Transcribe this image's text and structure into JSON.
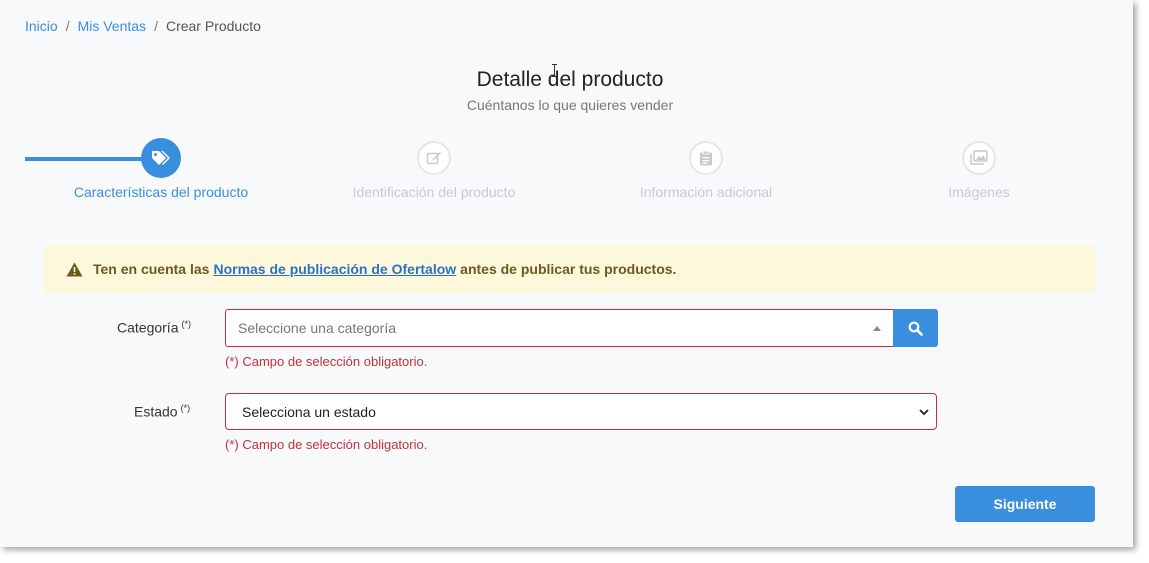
{
  "breadcrumb": {
    "items": [
      "Inicio",
      "Mis Ventas"
    ],
    "current": "Crear Producto",
    "separator": "/"
  },
  "header": {
    "title": "Detalle del producto",
    "subtitle": "Cuéntanos lo que quieres vender"
  },
  "steps": [
    {
      "label": "Características del producto",
      "icon": "tags-icon",
      "state": "active"
    },
    {
      "label": "Identificación del producto",
      "icon": "edit-icon",
      "state": "inactive"
    },
    {
      "label": "Información adicional",
      "icon": "clipboard-icon",
      "state": "inactive"
    },
    {
      "label": "Imágenes",
      "icon": "images-icon",
      "state": "inactive"
    }
  ],
  "alert": {
    "prefix": "Ten en cuenta las",
    "link": "Normas de publicación de Ofertalow",
    "suffix": "antes de publicar tus productos.",
    "icon": "warning-icon"
  },
  "form": {
    "category": {
      "label": "Categoría",
      "required_mark": "(*)",
      "placeholder": "Seleccione una categoría",
      "error": "(*) Campo de selección obligatorio."
    },
    "state": {
      "label": "Estado",
      "required_mark": "(*)",
      "value": "Selecciona un estado",
      "error": "(*) Campo de selección obligatorio."
    }
  },
  "actions": {
    "next_label": "Siguiente"
  },
  "colors": {
    "accent": "#3a8ede",
    "error": "#c2313a",
    "alert_bg": "#fdf8dc"
  }
}
